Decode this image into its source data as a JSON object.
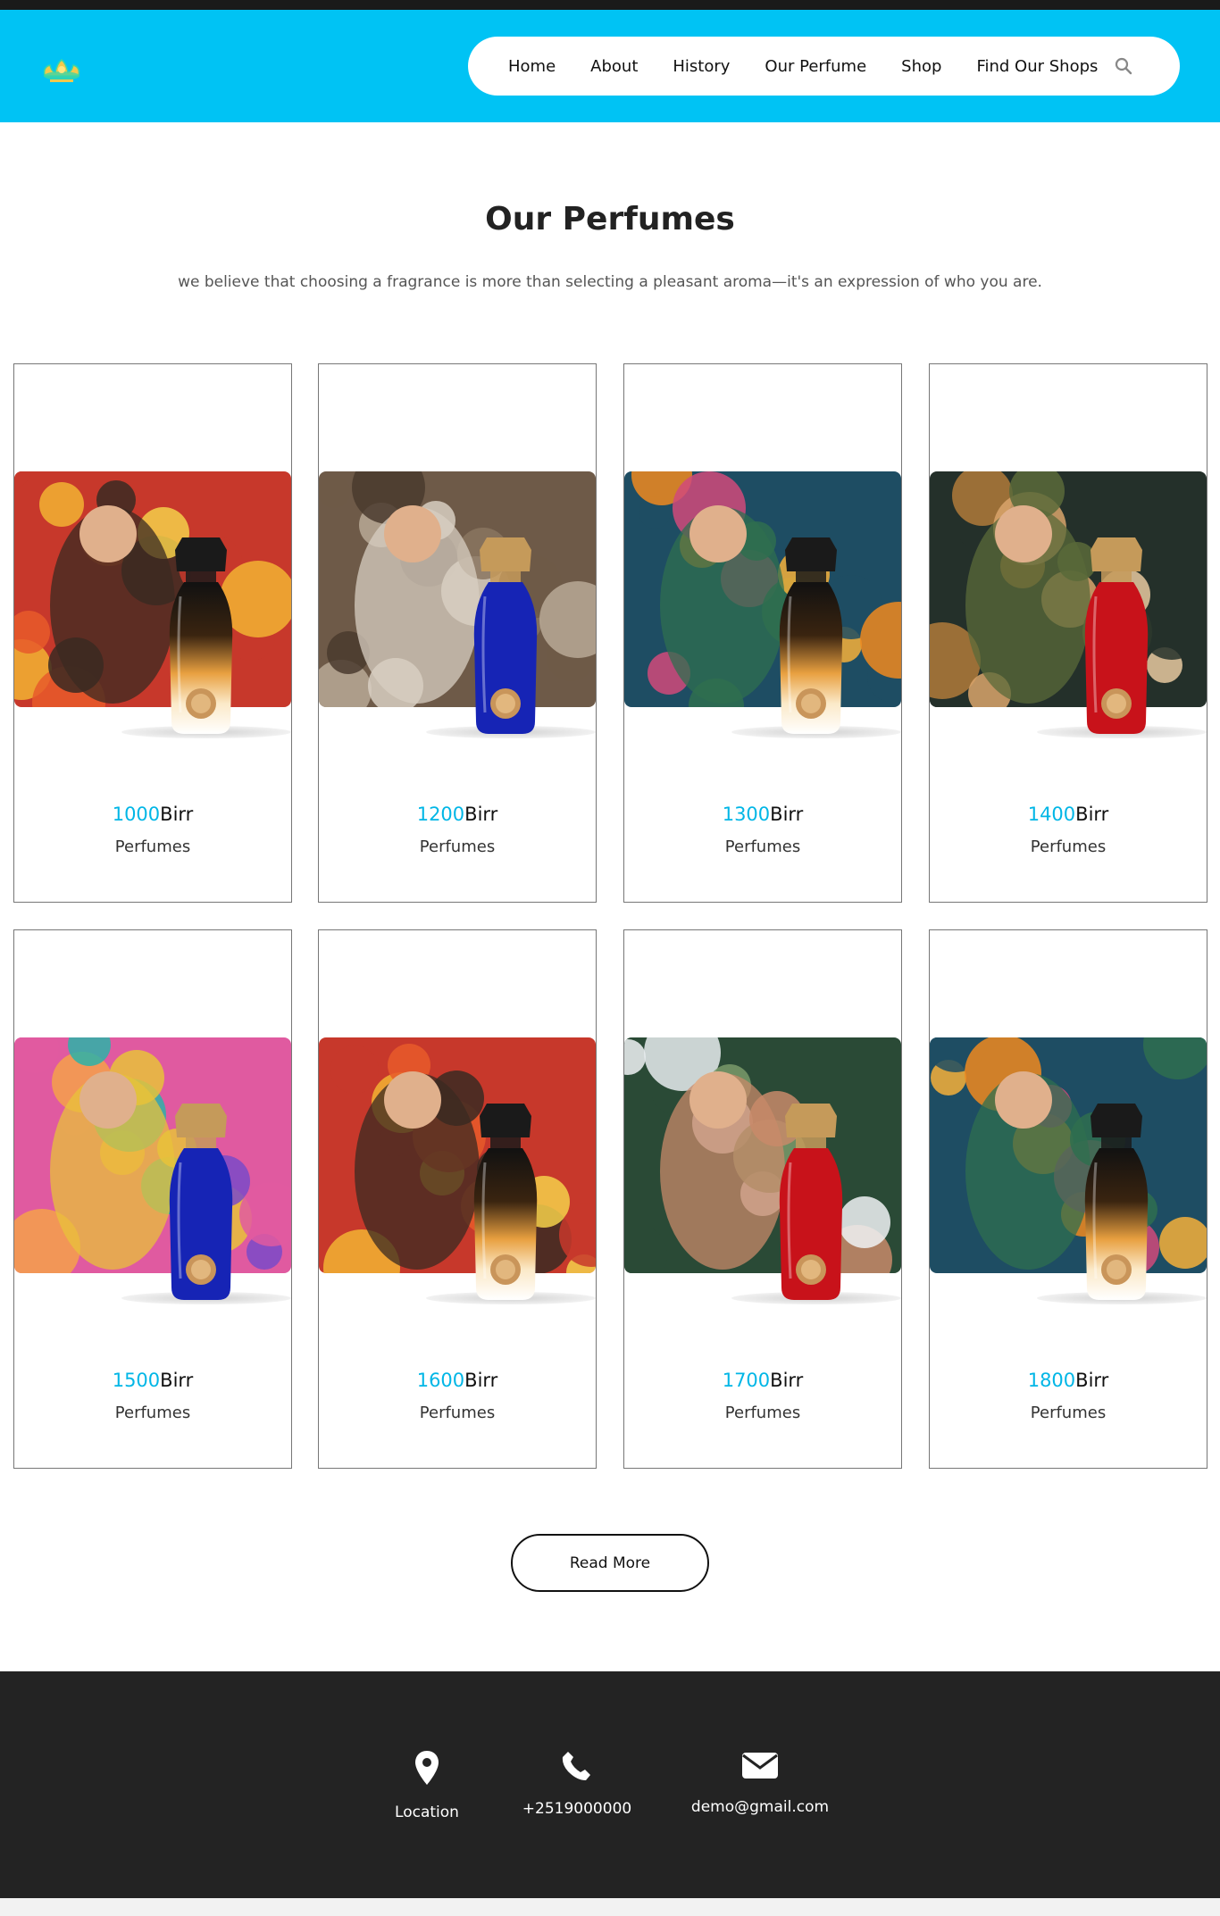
{
  "colors": {
    "header_bg": "#00c3f4",
    "accent": "#00b6e6",
    "footer_bg": "#232323",
    "text_dark": "#222222"
  },
  "header": {
    "logo_icon": "crown-logo-icon",
    "nav": [
      {
        "label": "Home",
        "active": true
      },
      {
        "label": "About",
        "active": false
      },
      {
        "label": "History",
        "active": true
      },
      {
        "label": "Our Perfume",
        "active": false
      },
      {
        "label": "Shop",
        "active": false
      },
      {
        "label": "Find Our Shops",
        "active": false
      }
    ],
    "search_icon": "search-icon"
  },
  "section": {
    "title": "Our Perfumes",
    "subtitle": "we believe that choosing a fragrance is more than selecting a pleasant aroma—it's an expression of who you are."
  },
  "products": [
    {
      "price": "1000",
      "currency": "Birr",
      "label": "Perfumes",
      "bottle": "amber-black-cap",
      "scene": "couple-fruits"
    },
    {
      "price": "1200",
      "currency": "Birr",
      "label": "Perfumes",
      "bottle": "blue-gold-cap",
      "scene": "driftwood"
    },
    {
      "price": "1300",
      "currency": "Birr",
      "label": "Perfumes",
      "bottle": "amber-black-cap",
      "scene": "man-oranges"
    },
    {
      "price": "1400",
      "currency": "Birr",
      "label": "Perfumes",
      "bottle": "red-gold-cap",
      "scene": "woman-leaves"
    },
    {
      "price": "1500",
      "currency": "Birr",
      "label": "Perfumes",
      "bottle": "blue-gold-cap",
      "scene": "man-tropical"
    },
    {
      "price": "1600",
      "currency": "Birr",
      "label": "Perfumes",
      "bottle": "amber-black-cap",
      "scene": "couple-fruits"
    },
    {
      "price": "1700",
      "currency": "Birr",
      "label": "Perfumes",
      "bottle": "red-gold-cap",
      "scene": "woman-jasmine"
    },
    {
      "price": "1800",
      "currency": "Birr",
      "label": "Perfumes",
      "bottle": "amber-black-cap",
      "scene": "man-oranges"
    }
  ],
  "read_more_label": "Read More",
  "footer": {
    "location": {
      "icon": "map-pin-icon",
      "label": "Location"
    },
    "phone": {
      "icon": "phone-icon",
      "label": "+2519000000"
    },
    "email": {
      "icon": "envelope-icon",
      "label": "demo@gmail.com"
    }
  }
}
